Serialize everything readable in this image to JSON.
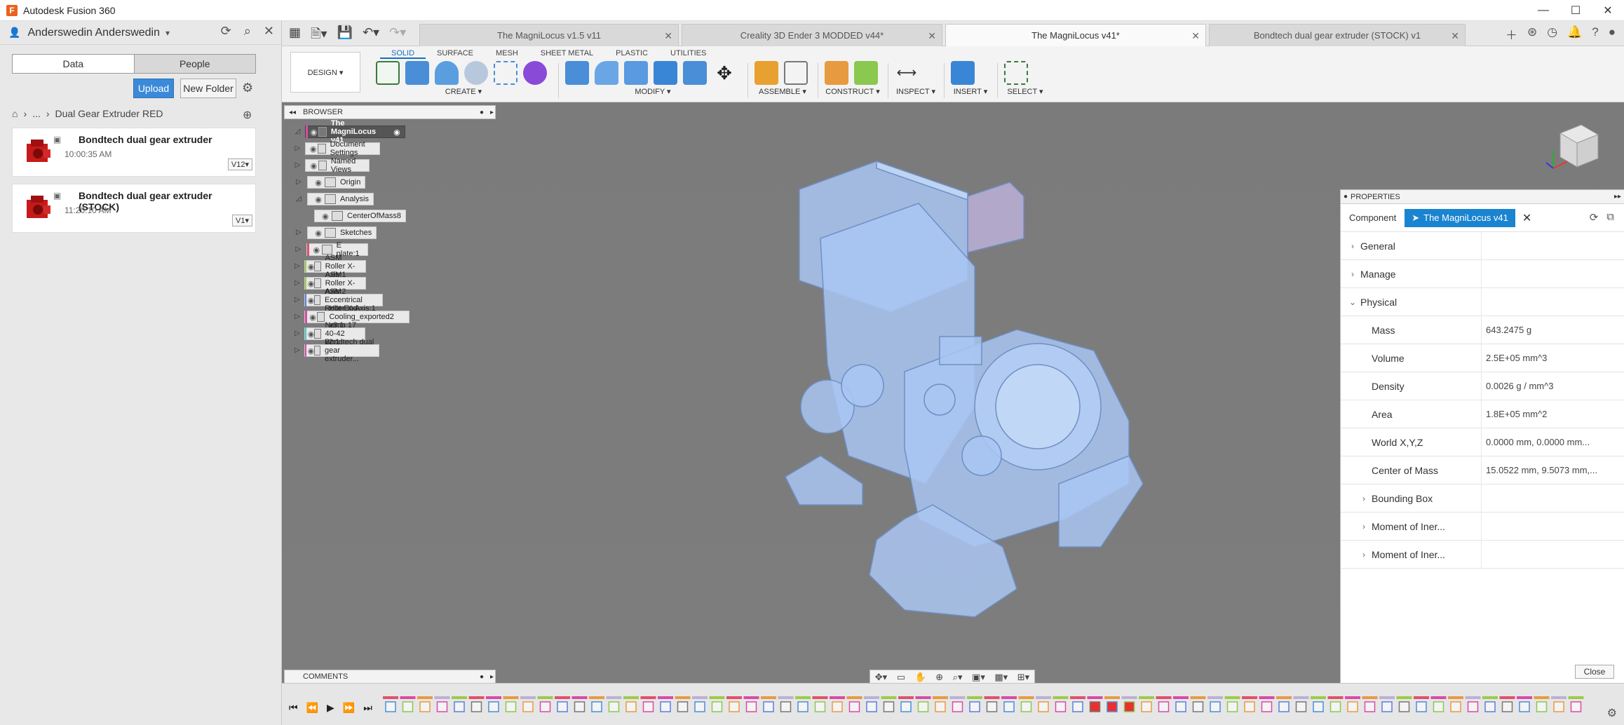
{
  "app": {
    "title": "Autodesk Fusion 360",
    "logo_letter": "F",
    "window_buttons": [
      "—",
      "☐",
      "✕"
    ]
  },
  "data_panel": {
    "user_name": "Anderswedin Anderswedin",
    "tabs": [
      "Data",
      "People"
    ],
    "upload_label": "Upload",
    "new_folder_label": "New Folder",
    "breadcrumb": [
      "...",
      "Dual Gear Extruder RED"
    ],
    "files": [
      {
        "name": "Bondtech dual gear extruder",
        "time": "10:00:35 AM",
        "version": "V12▾"
      },
      {
        "name": "Bondtech dual gear extruder (STOCK)",
        "time": "11:20:10 AM",
        "version": "V1▾"
      }
    ]
  },
  "doc_tabs": [
    {
      "label": "The MagniLocus v1.5 v11",
      "active": false
    },
    {
      "label": "Creality 3D Ender 3 MODDED v44*",
      "active": false
    },
    {
      "label": "The MagniLocus v41*",
      "active": true
    },
    {
      "label": "Bondtech dual gear extruder (STOCK) v1",
      "active": false
    }
  ],
  "toolbar": {
    "design_label": "DESIGN ▾",
    "subtabs": [
      "SOLID",
      "SURFACE",
      "MESH",
      "SHEET METAL",
      "PLASTIC",
      "UTILITIES"
    ],
    "groups": [
      "CREATE ▾",
      "MODIFY ▾",
      "ASSEMBLE ▾",
      "CONSTRUCT ▾",
      "INSPECT ▾",
      "INSERT ▾",
      "SELECT ▾"
    ]
  },
  "browser": {
    "header": "BROWSER",
    "root": "The MagniLocus v41",
    "nodes": [
      {
        "label": "Document Settings",
        "color": ""
      },
      {
        "label": "Named Views",
        "color": ""
      },
      {
        "label": "Origin",
        "color": ""
      },
      {
        "label": "Analysis",
        "color": ""
      },
      {
        "label": "CenterOfMass8",
        "color": ""
      },
      {
        "label": "Sketches",
        "color": ""
      },
      {
        "label": "E plate:1",
        "color": "#e2506a"
      },
      {
        "label": "ASM Roller X-Axis:1",
        "color": "#9ccc46"
      },
      {
        "label": "ASM Roller X-Axis:2",
        "color": "#9ccc46"
      },
      {
        "label": "ASM Eccentrical Roller X-Axis:1",
        "color": "#5a7fe0"
      },
      {
        "label": "Hot-End-Cooling_exported2 v3:1",
        "color": "#d94aa8"
      },
      {
        "label": "Nema 17 40-42 v2:1",
        "color": "#4ac8c8"
      },
      {
        "label": "Bondtech dual gear extruder...",
        "color": "#d94aa8"
      }
    ]
  },
  "properties": {
    "header": "PROPERTIES",
    "component_label": "Component",
    "component_value": "The MagniLocus v41",
    "sections": [
      {
        "label": "General",
        "value": "",
        "type": "section"
      },
      {
        "label": "Manage",
        "value": "",
        "type": "section"
      },
      {
        "label": "Physical",
        "value": "",
        "type": "section-open"
      },
      {
        "label": "Mass",
        "value": "643.2475 g",
        "type": "prop"
      },
      {
        "label": "Volume",
        "value": "2.5E+05 mm^3",
        "type": "prop"
      },
      {
        "label": "Density",
        "value": "0.0026 g / mm^3",
        "type": "prop"
      },
      {
        "label": "Area",
        "value": "1.8E+05 mm^2",
        "type": "prop"
      },
      {
        "label": "World X,Y,Z",
        "value": "0.0000 mm, 0.0000 mm...",
        "type": "prop"
      },
      {
        "label": "Center of Mass",
        "value": "15.0522 mm, 9.5073 mm,...",
        "type": "prop"
      },
      {
        "label": "Bounding Box",
        "value": "",
        "type": "subsection"
      },
      {
        "label": "Moment of Iner...",
        "value": "",
        "type": "subsection"
      },
      {
        "label": "Moment of Iner...",
        "value": "",
        "type": "subsection"
      }
    ],
    "close_label": "Close"
  },
  "comments": {
    "label": "COMMENTS"
  },
  "colors": {
    "accent": "#1a84d0",
    "model_fill": "#a9c6f2",
    "model_stroke": "#6f8fc4",
    "viewport_bg": "#7b7b7b"
  }
}
